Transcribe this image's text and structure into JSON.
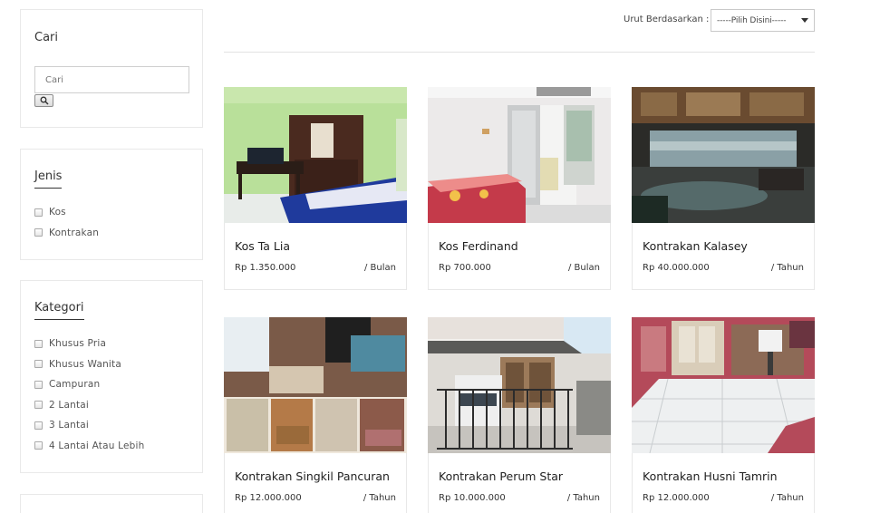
{
  "search": {
    "title": "Cari",
    "placeholder": "Cari"
  },
  "jenis": {
    "title": "Jenis",
    "options": [
      "Kos",
      "Kontrakan"
    ]
  },
  "kategori": {
    "title": "Kategori",
    "options": [
      "Khusus Pria",
      "Khusus Wanita",
      "Campuran",
      "2 Lantai",
      "3 Lantai",
      "4 Lantai Atau Lebih"
    ]
  },
  "sort": {
    "label": "Urut Berdasarkan :",
    "selected": "-----Pilih Disini-----"
  },
  "listings": [
    {
      "name": "Kos Ta Lia",
      "price": "Rp 1.350.000",
      "period": "/ Bulan"
    },
    {
      "name": "Kos Ferdinand",
      "price": "Rp 700.000",
      "period": "/ Bulan"
    },
    {
      "name": "Kontrakan Kalasey",
      "price": "Rp 40.000.000",
      "period": "/ Tahun"
    },
    {
      "name": "Kontrakan Singkil Pancuran",
      "price": "Rp 12.000.000",
      "period": "/ Tahun"
    },
    {
      "name": "Kontrakan Perum Star",
      "price": "Rp 10.000.000",
      "period": "/ Tahun"
    },
    {
      "name": "Kontrakan Husni Tamrin",
      "price": "Rp 12.000.000",
      "period": "/ Tahun"
    }
  ],
  "icons": {
    "search_button": "search-icon",
    "sort_caret": "caret-down-icon"
  }
}
